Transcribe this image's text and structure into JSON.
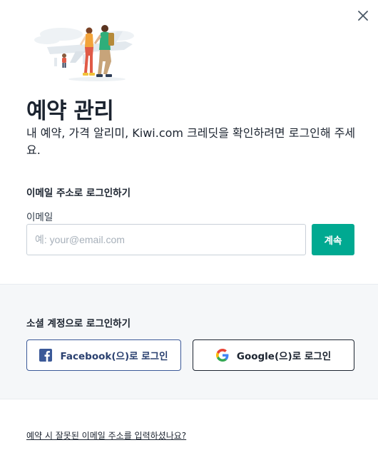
{
  "modal": {
    "title": "예약 관리",
    "subtitle": "내 예약, 가격 알리미, Kiwi.com 크레딧을 확인하려면 로그인해 주세요."
  },
  "email_section": {
    "heading": "이메일 주소로 로그인하기",
    "label": "이메일",
    "placeholder": "예: your@email.com",
    "value": "",
    "continue_label": "계속"
  },
  "social_section": {
    "heading": "소셜 계정으로 로그인하기",
    "facebook_label": "Facebook(으)로 로그인",
    "google_label": "Google(으)로 로그인"
  },
  "footer": {
    "wrong_email_link": "예약 시 잘못된 이메일 주소를 입력하셨나요?"
  },
  "icons": {
    "close": "close-icon",
    "facebook": "facebook-icon",
    "google": "google-icon"
  },
  "colors": {
    "accent": "#00a991",
    "facebook": "#3b5998",
    "text": "#1c2430",
    "social_bg": "#f5f7f9"
  }
}
